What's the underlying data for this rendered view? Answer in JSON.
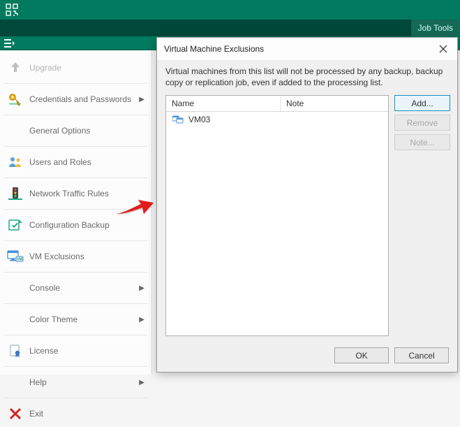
{
  "header": {
    "tab_label": "Job Tools"
  },
  "menu": {
    "upgrade": "Upgrade",
    "credentials": "Credentials and Passwords",
    "general": "General Options",
    "users": "Users and Roles",
    "network": "Network Traffic Rules",
    "config_backup": "Configuration Backup",
    "vm_exclusions": "VM Exclusions",
    "console": "Console",
    "color_theme": "Color Theme",
    "license": "License",
    "help": "Help",
    "exit": "Exit"
  },
  "dialog": {
    "title": "Virtual Machine Exclusions",
    "description": "Virtual machines from this list will not be processed by any backup, backup copy or replication job, even if added to the processing list.",
    "columns": {
      "name": "Name",
      "note": "Note"
    },
    "rows": [
      {
        "name": "VM03",
        "note": ""
      }
    ],
    "buttons": {
      "add": "Add...",
      "remove": "Remove",
      "note": "Note...",
      "ok": "OK",
      "cancel": "Cancel"
    }
  }
}
